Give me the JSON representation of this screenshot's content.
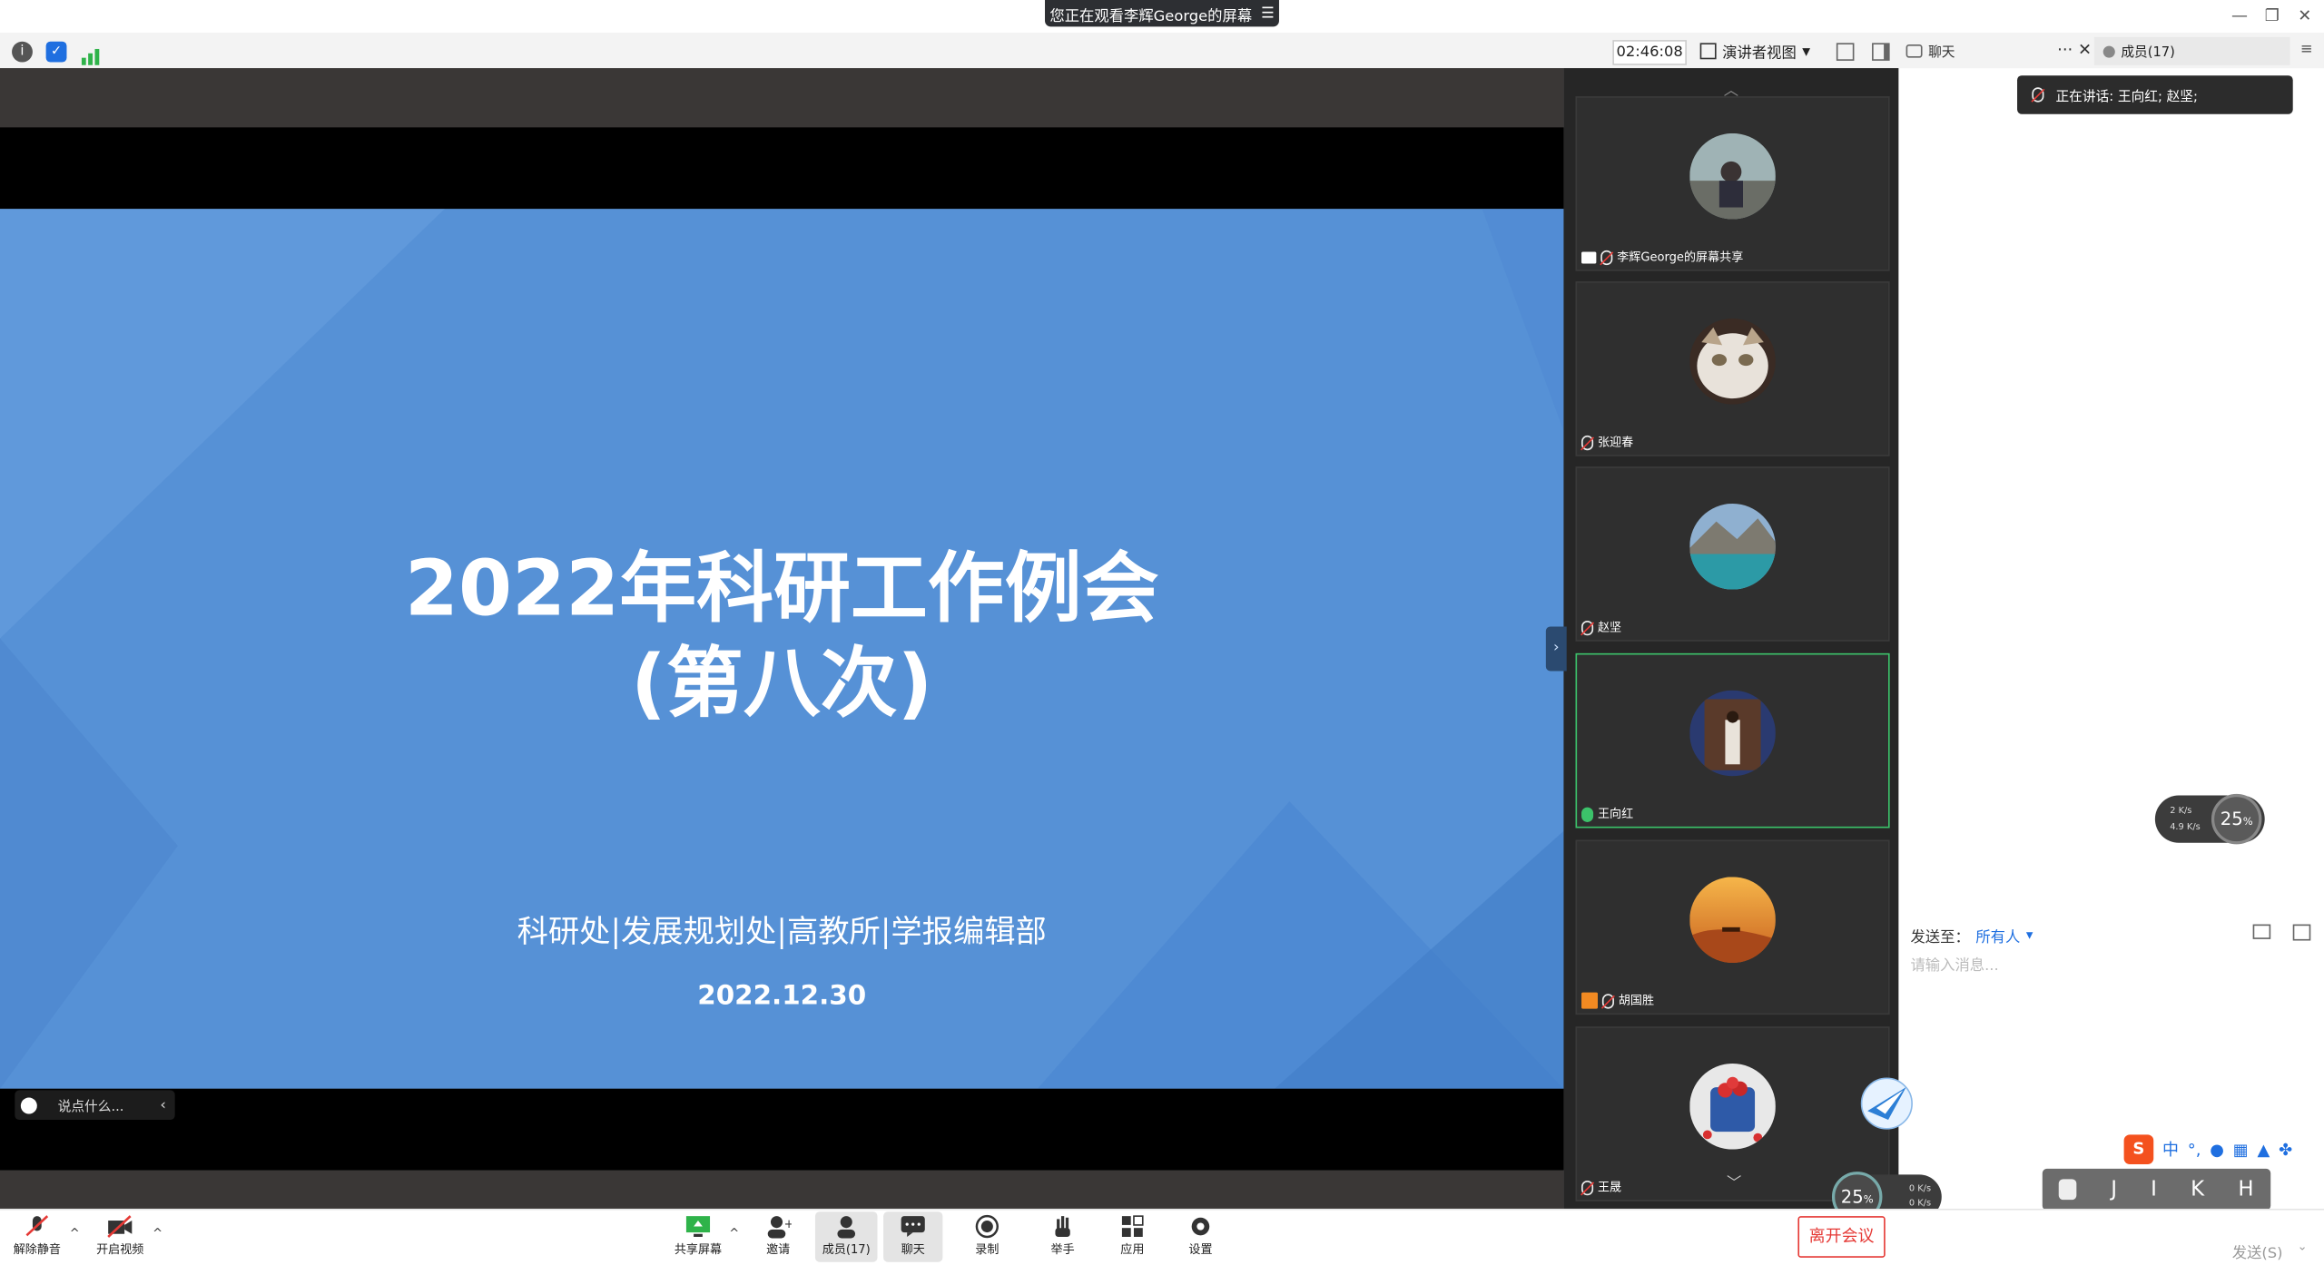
{
  "titlebar": {
    "banner": "您正在观看李辉George的屏幕",
    "menu_icon": "list-icon"
  },
  "toolbar": {
    "timer": "02:46:08",
    "view_mode": "演讲者视图",
    "chat_tab": "聊天",
    "members_tab": "成员(17)",
    "more": "···"
  },
  "slide": {
    "title_line1": "2022年科研工作例会",
    "title_line2": "(第八次)",
    "departments": "科研处|发展规划处|高教所|学报编辑部",
    "date": "2022.12.30"
  },
  "comment": {
    "placeholder": "说点什么..."
  },
  "participants": [
    {
      "name": "李辉George的屏幕共享"
    },
    {
      "name": "张迎春"
    },
    {
      "name": "赵坚"
    },
    {
      "name": "王向红"
    },
    {
      "name": "胡国胜"
    },
    {
      "name": "王晟"
    }
  ],
  "chat": {
    "speaking": "正在讲话: 王向红; 赵坚;",
    "send_to_label": "发送至：",
    "send_to_value": "所有人",
    "input_placeholder": "请输入消息...",
    "send_button": "发送(S)"
  },
  "net_widget_1": {
    "up": "2",
    "down": "4.9",
    "unit": "K/s",
    "percent": "25",
    "pct": "%"
  },
  "net_widget_2": {
    "up": "0",
    "down": "0",
    "unit": "K/s",
    "percent": "25",
    "pct": "%"
  },
  "ime": {
    "mode": "中",
    "keys": [
      "J",
      "I",
      "K",
      "H"
    ]
  },
  "controls": {
    "unmute": "解除静音",
    "start_video": "开启视频",
    "share": "共享屏幕",
    "invite": "邀请",
    "members": "成员(17)",
    "chat": "聊天",
    "record": "录制",
    "raise_hand": "举手",
    "apps": "应用",
    "settings": "设置",
    "leave": "离开会议"
  },
  "colors": {
    "slide_blue": "#5691d6",
    "active_border": "#3cc26a",
    "leave_red": "#e53935",
    "link_blue": "#1f6fe0"
  }
}
